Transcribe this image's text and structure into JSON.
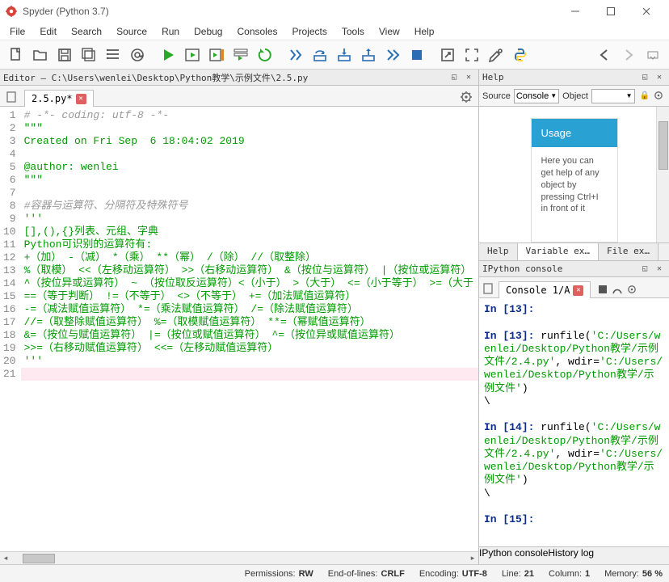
{
  "window": {
    "title": "Spyder (Python 3.7)"
  },
  "menu": [
    "File",
    "Edit",
    "Search",
    "Source",
    "Run",
    "Debug",
    "Consoles",
    "Projects",
    "Tools",
    "View",
    "Help"
  ],
  "editor_pane": {
    "title": "Editor — C:\\Users\\wenlei\\Desktop\\Python教学\\示例文件\\2.5.py",
    "tab": "2.5.py*"
  },
  "code_lines": [
    {
      "n": 1,
      "cls": "c-gray",
      "t": "# -*- coding: utf-8 -*-"
    },
    {
      "n": 2,
      "cls": "c-green",
      "t": "\"\"\""
    },
    {
      "n": 3,
      "cls": "c-green",
      "t": "Created on Fri Sep  6 18:04:02 2019"
    },
    {
      "n": 4,
      "cls": "c-green",
      "t": ""
    },
    {
      "n": 5,
      "cls": "c-green",
      "t": "@author: wenlei"
    },
    {
      "n": 6,
      "cls": "c-green",
      "t": "\"\"\""
    },
    {
      "n": 7,
      "cls": "",
      "t": ""
    },
    {
      "n": 8,
      "cls": "c-gray",
      "t": "#容器与运算符、分隔符及特殊符号"
    },
    {
      "n": 9,
      "cls": "c-green",
      "t": "'''"
    },
    {
      "n": 10,
      "cls": "c-green",
      "t": "[],(),{}列表、元组、字典"
    },
    {
      "n": 11,
      "cls": "c-green",
      "t": "Python可识别的运算符有:"
    },
    {
      "n": 12,
      "cls": "c-green",
      "t": "+（加） -（减） *（乘） **（幂） /（除） //（取整除）"
    },
    {
      "n": 13,
      "cls": "c-green",
      "t": "%（取模） <<（左移动运算符） >>（右移动运算符） &（按位与运算符） |（按位或运算符）"
    },
    {
      "n": 14,
      "cls": "c-green",
      "t": "^（按位异或运算符） ~ （按位取反运算符）<（小于） >（大于） <=（小于等于） >=（大于"
    },
    {
      "n": 15,
      "cls": "c-green",
      "t": "==（等于判断） !=（不等于） <>（不等于） +=（加法赋值运算符）"
    },
    {
      "n": 16,
      "cls": "c-green",
      "t": "-=（减法赋值运算符） *=（乘法赋值运算符） /=（除法赋值运算符）"
    },
    {
      "n": 17,
      "cls": "c-green",
      "t": "//=（取整除赋值运算符） %=（取模赋值运算符） **=（幂赋值运算符）"
    },
    {
      "n": 18,
      "cls": "c-green",
      "t": "&=（按位与赋值运算符） |=（按位或赋值运算符） ^=（按位异或赋值运算符）"
    },
    {
      "n": 19,
      "cls": "c-green",
      "t": ">>=（右移动赋值运算符） <<=（左移动赋值运算符）"
    },
    {
      "n": 20,
      "cls": "c-green",
      "t": "'''"
    },
    {
      "n": 21,
      "cls": "",
      "t": "",
      "cur": true
    }
  ],
  "help": {
    "title": "Help",
    "source_label": "Source",
    "source_value": "Console",
    "object_label": "Object",
    "object_value": "",
    "card_title": "Usage",
    "card_body": "Here you can get help of any object by pressing Ctrl+I in front of it",
    "tabs": [
      "Help",
      "Variable ex…",
      "File ex…"
    ]
  },
  "ipython": {
    "title": "IPython console",
    "tab": "Console 1/A",
    "lines": [
      {
        "kind": "prompt",
        "t": "In [13]:"
      },
      {
        "kind": "blank",
        "t": ""
      },
      {
        "kind": "run",
        "prompt": "In [13]:",
        "fn": "runfile(",
        "arg1": "'C:/Users/wenlei/Desktop/Python教学/示例文件/2.4.py'",
        "mid": ", wdir=",
        "arg2": "'C:/Users/wenlei/Desktop/Python教学/示例文件'",
        "end": ")"
      },
      {
        "kind": "plain",
        "t": "\\"
      },
      {
        "kind": "blank",
        "t": ""
      },
      {
        "kind": "run",
        "prompt": "In [14]:",
        "fn": "runfile(",
        "arg1": "'C:/Users/wenlei/Desktop/Python教学/示例文件/2.4.py'",
        "mid": ", wdir=",
        "arg2": "'C:/Users/wenlei/Desktop/Python教学/示例文件'",
        "end": ")"
      },
      {
        "kind": "plain",
        "t": "\\"
      },
      {
        "kind": "blank",
        "t": ""
      },
      {
        "kind": "prompt",
        "t": "In [15]:"
      }
    ],
    "bottom_tabs": [
      "IPython console",
      "History log"
    ]
  },
  "status": {
    "perm_label": "Permissions:",
    "perm": "RW",
    "eol_label": "End-of-lines:",
    "eol": "CRLF",
    "enc_label": "Encoding:",
    "enc": "UTF-8",
    "line_label": "Line:",
    "line": "21",
    "col_label": "Column:",
    "col": "1",
    "mem_label": "Memory:",
    "mem": "56 %"
  }
}
